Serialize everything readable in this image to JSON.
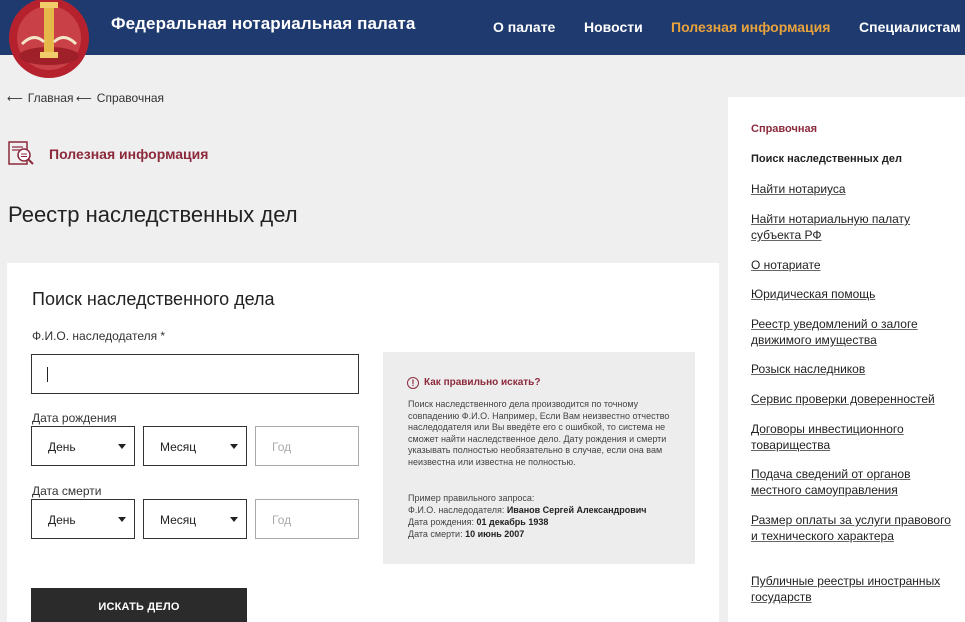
{
  "header": {
    "site_title": "Федеральная нотариальная палата",
    "nav": [
      "О палате",
      "Новости",
      "Полезная информация",
      "Специалистам"
    ],
    "accent_color": "#e8a33c",
    "bg_color": "#1f3a6e"
  },
  "breadcrumb": [
    "Главная",
    "Справочная"
  ],
  "section": {
    "label": "Полезная информация",
    "icon": "document-search-icon"
  },
  "page_title": "Реестр наследственных дел",
  "form": {
    "title": "Поиск наследственного дела",
    "fio_label": "Ф.И.О. наследодателя *",
    "fio_value": "",
    "birth_label": "Дата рождения",
    "death_label": "Дата смерти",
    "day_value": "День",
    "month_value": "Месяц",
    "year_placeholder": "Год",
    "submit_label": "ИСКАТЬ ДЕЛО"
  },
  "help": {
    "title": "Как правильно искать?",
    "text": "Поиск наследственного дела производится по точному совпадению Ф.И.О. Например, Если Вам неизвестно отчество наследодателя или Вы введёте его с ошибкой, то система не сможет найти наследственное дело. Дату рождения и смерти указывать полностью необязательно в случае, если она вам неизвестна или известна не полностью.",
    "example_heading": "Пример правильного запроса:",
    "example_fio_label": "Ф.И.О. наследодателя: ",
    "example_fio_value": "Иванов Сергей Александрович",
    "example_birth_label": "Дата рождения: ",
    "example_birth_value": "01 декабрь 1938",
    "example_death_label": "Дата смерти: ",
    "example_death_value": "10 июнь 2007"
  },
  "sidebar": {
    "heading": "Справочная",
    "current": "Поиск наследственных дел",
    "links": [
      "Найти нотариуса",
      "Найти нотариальную палату субъекта РФ",
      "О нотариате",
      "Юридическая помощь",
      "Реестр уведомлений о залоге движимого имущества",
      "Розыск наследников",
      "Сервис проверки доверенностей",
      "Договоры инвестиционного товарищества",
      "Подача сведений от органов местного самоуправления",
      "Размер оплаты за услуги правового и технического характера",
      "Публичные реестры иностранных государств"
    ]
  }
}
